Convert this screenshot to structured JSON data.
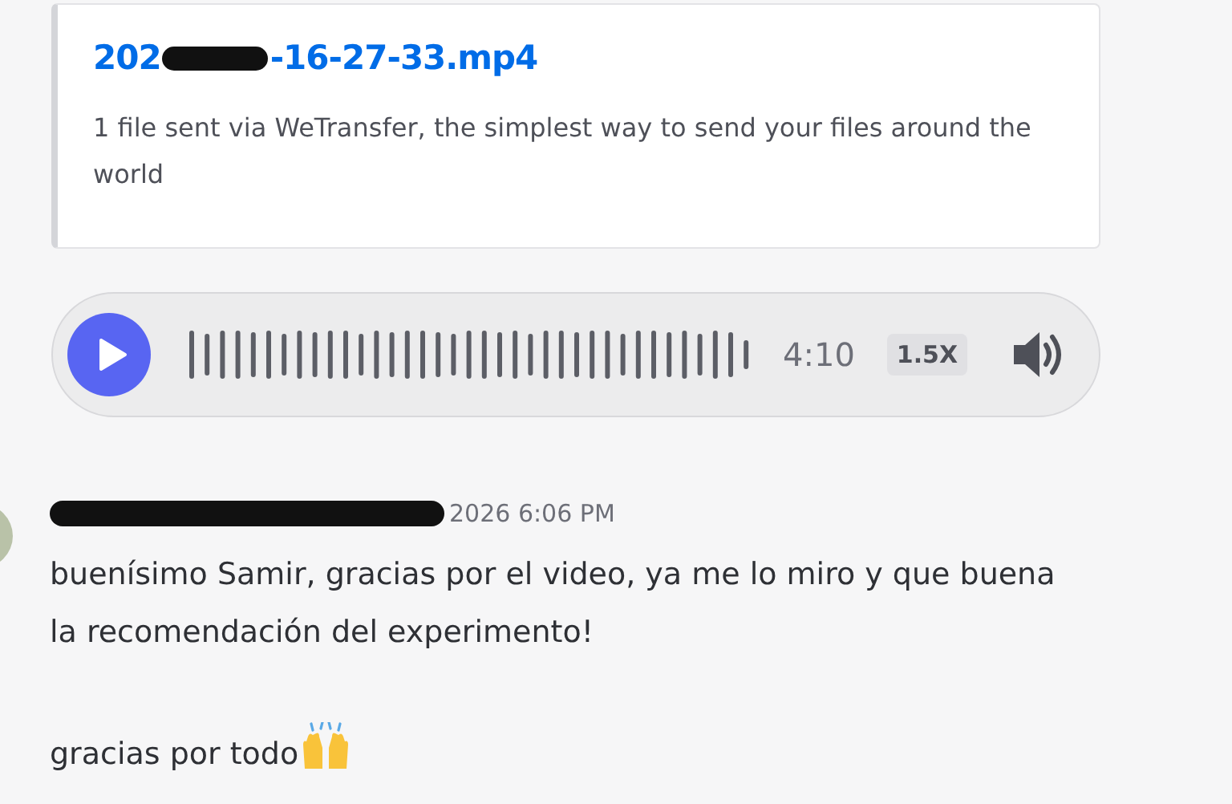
{
  "embed": {
    "title_start": "202",
    "title_end": "-16-27-33.mp4",
    "title_redacted": true,
    "description": "1 file sent via WeTransfer, the simplest way to send your files around the world"
  },
  "audio_player": {
    "playing": false,
    "duration": "4:10",
    "speed": "1.5X"
  },
  "message": {
    "author_redacted": true,
    "timestamp": "2026 6:06 PM",
    "paragraphs": [
      "buenísimo Samir, gracias por el video, ya me lo miro y que buena la recomendación del experimento!",
      "gracias por todo"
    ]
  }
}
